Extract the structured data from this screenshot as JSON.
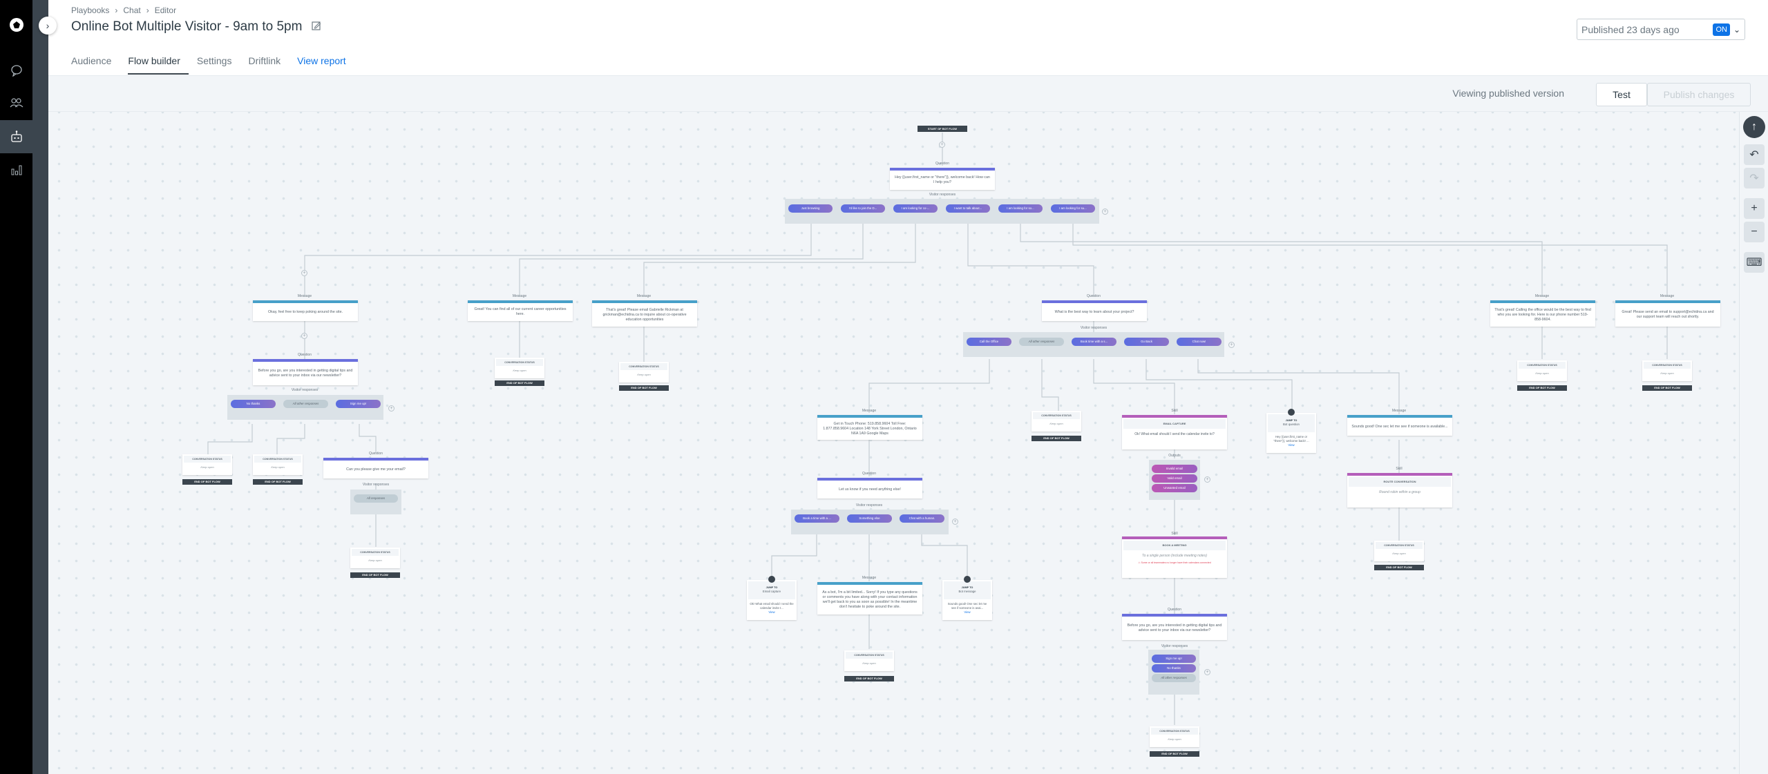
{
  "nav": {
    "items": [
      {
        "icon": "logo-icon",
        "active": false
      },
      {
        "icon": "chat-bubble-icon",
        "active": false
      },
      {
        "icon": "users-icon",
        "active": false
      },
      {
        "icon": "bot-icon",
        "active": true
      },
      {
        "icon": "bar-chart-icon",
        "active": false
      }
    ]
  },
  "header": {
    "breadcrumbs": [
      "Playbooks",
      "Chat",
      "Editor"
    ],
    "title": "Online Bot Multiple Visitor - 9am to 5pm",
    "tabs": [
      {
        "label": "Audience",
        "active": false
      },
      {
        "label": "Flow builder",
        "active": true
      },
      {
        "label": "Settings",
        "active": false
      },
      {
        "label": "Driftlink",
        "active": false
      },
      {
        "label": "View report",
        "active": false,
        "link": true
      }
    ],
    "publish_status": "Published 23 days ago",
    "toggle": "ON"
  },
  "toolbar": {
    "viewing": "Viewing published version",
    "test": "Test",
    "publish": "Publish changes"
  },
  "labels": {
    "question": "Question",
    "message": "Message",
    "skill": "Skill",
    "visitor_responses": "Visitor responses",
    "outputs": "Outputs",
    "conv_status": "CONVERSATION STATUS",
    "keep_open": "Keep open",
    "end": "END OF BOT FLOW",
    "start": "START OF BOT FLOW",
    "jump_to": "JUMP TO",
    "view": "View",
    "all_other": "All other responses",
    "all_responses": "All responses"
  },
  "flow": {
    "root_question": "Hey {{user.first_name or \"there\"}}, welcome back! How can I help you?",
    "root_responses": [
      "Just browsing",
      "I'd like to join the D...",
      "I am looking for co-...",
      "I want to talk about...",
      "I am looking for so...",
      "I am looking for su..."
    ],
    "msg_browsing": "Okay, feel free to keep poking around the site.",
    "q_newsletter": "Before you go, are you interested in getting digital tips and advice sent to your inbox via our newsletter?",
    "newsletter_responses": [
      "No thanks",
      "All other responses",
      "Sign me up!"
    ],
    "q_email": "Can you please give me your email?",
    "msg_careers": "Great! You can find all of our current career opportunities here.",
    "msg_coop": "That's great! Please email Gabrielle Rickman at grickman@echidna.ca to inquire about co-operative education opportunities",
    "q_project": "What is the best way to learn about your project?",
    "project_responses": [
      "Call the Office",
      "All other responses",
      "Book time with a s...",
      "Go Back",
      "Chat now!"
    ],
    "msg_office": "That's great! Calling the office would be the best way to find who you are looking for. Here is our phone number 519-858-9604.",
    "msg_support": "Great! Please send an email to support@echidna.ca and our support team will reach out shortly.",
    "msg_contact": "Get in Touch Phone: 519.858.9604 Toll Free: 1.877.858.9604 Location 148 York Street London, Ontario N6A 1A9 Google Maps",
    "q_else": "Let us know if you need anything else!",
    "else_responses": [
      "Book a time with a ...",
      "Something else",
      "Chat with a human."
    ],
    "msg_limited": "As a bot, I'm a bit limited... Sorry! If you type any questions or comments you have along with your contact information we'll get back to you as soon as possible! In the meantime don't hesitate to poke around the site.",
    "jump_email": {
      "target": "Email capture",
      "preview": "Ok! What email should I send the calendar invite t..."
    },
    "jump_botmsg": {
      "target": "Bot message",
      "preview": "Sounds good! One sec let me see if someone is avai..."
    },
    "jump_botq": {
      "target": "Bot question",
      "preview": "Hey {{user.first_name or \"there\"}}, welcome back! ..."
    },
    "skill_email": {
      "title": "EMAIL CAPTURE",
      "body": "Ok! What email should I send the calendar invite to?",
      "outputs": [
        "Invalid email",
        "Valid email",
        "Unwanted email"
      ]
    },
    "skill_meeting": {
      "title": "BOOK A MEETING",
      "body": "To a single person (include meeting notes)",
      "warning": "Some or all teammates no longer have their calendars connected"
    },
    "newsletter2_responses": [
      "Sign me up!",
      "No thanks",
      "All other responses"
    ],
    "msg_sounds_good": "Sounds good! One sec let me see if someone is available...",
    "skill_route": {
      "title": "ROUTE CONVERSATION",
      "body": "Round robin within a group"
    }
  }
}
